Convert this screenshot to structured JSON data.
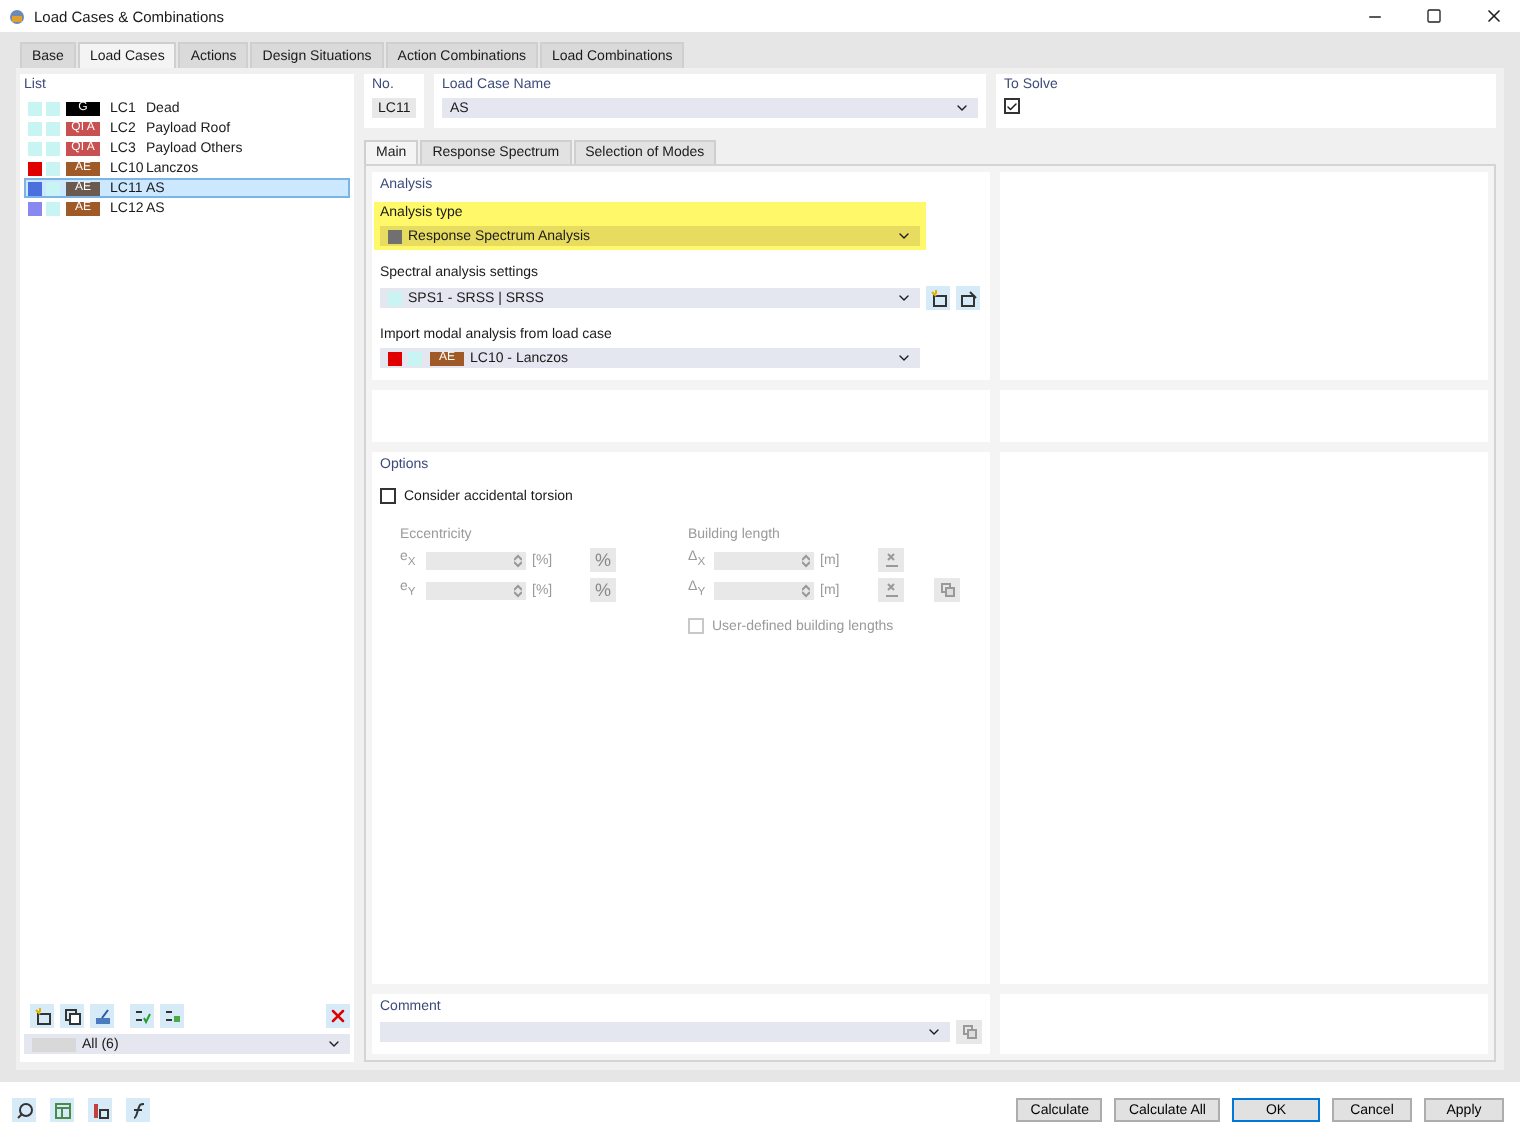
{
  "window": {
    "title": "Load Cases & Combinations"
  },
  "tabs": [
    {
      "label": "Base",
      "selected": false
    },
    {
      "label": "Load Cases",
      "selected": true
    },
    {
      "label": "Actions",
      "selected": false
    },
    {
      "label": "Design Situations",
      "selected": false
    },
    {
      "label": "Action Combinations",
      "selected": false
    },
    {
      "label": "Load Combinations",
      "selected": false
    }
  ],
  "list": {
    "title": "List",
    "items": [
      {
        "color": "#c8f4f4",
        "tag": {
          "text": "G",
          "color": "#000000"
        },
        "number": "LC1",
        "name": "Dead",
        "selected": false
      },
      {
        "color": "#c8f4f4",
        "tag": {
          "text": "QI A",
          "color": "#c85050"
        },
        "number": "LC2",
        "name": "Payload Roof",
        "selected": false
      },
      {
        "color": "#c8f4f4",
        "tag": {
          "text": "QI A",
          "color": "#c85050"
        },
        "number": "LC3",
        "name": "Payload Others",
        "selected": false
      },
      {
        "color": "#e00000",
        "tag": {
          "text": "AE",
          "color": "#a05a28"
        },
        "number": "LC10",
        "name": "Lanczos",
        "selected": false
      },
      {
        "color": "#4a70e0",
        "tag": {
          "text": "AE",
          "color": "#6a5a50"
        },
        "number": "LC11",
        "name": "AS",
        "selected": true
      },
      {
        "color": "#8888f0",
        "tag": {
          "text": "AE",
          "color": "#a05a28"
        },
        "number": "LC12",
        "name": "AS",
        "selected": false
      }
    ],
    "filter": "All (6)"
  },
  "header": {
    "no_label": "No.",
    "no_value": "LC11",
    "name_label": "Load Case Name",
    "name_value": "AS",
    "solve_label": "To Solve",
    "to_solve": true
  },
  "subtabs": [
    {
      "label": "Main",
      "selected": true
    },
    {
      "label": "Response Spectrum",
      "selected": false
    },
    {
      "label": "Selection of Modes",
      "selected": false
    }
  ],
  "analysis": {
    "title": "Analysis",
    "type_label": "Analysis type",
    "type_value": "Response Spectrum Analysis",
    "spectral_label": "Spectral analysis settings",
    "spectral_value": "SPS1 - SRSS | SRSS",
    "import_label": "Import modal analysis from load case",
    "import_swatch": {
      "color": "#e00000"
    },
    "import_tag": {
      "text": "AE",
      "color": "#a05a28"
    },
    "import_value": "LC10 - Lanczos"
  },
  "options": {
    "title": "Options",
    "torsion_label": "Consider accidental torsion",
    "torsion": false,
    "eccentricity_label": "Eccentricity",
    "ecc_rows": [
      {
        "label": "e$_{X}$",
        "unit": "[%]",
        "symbol": "%"
      },
      {
        "label": "e$_{Y}$",
        "unit": "[%]",
        "symbol": "%"
      }
    ],
    "length_label": "Building length",
    "length_rows": [
      {
        "label": "Δ$_{X}$",
        "unit": "[m]"
      },
      {
        "label": "Δ$_{Y}$",
        "unit": "[m]"
      }
    ],
    "user_defined_label": "User-defined building lengths",
    "user_defined": false
  },
  "comment": {
    "label": "Comment"
  },
  "buttons": [
    {
      "label": "Calculate",
      "default": false
    },
    {
      "label": "Calculate All",
      "default": false
    },
    {
      "label": "OK",
      "default": true
    },
    {
      "label": "Cancel",
      "default": false
    },
    {
      "label": "Apply",
      "default": false
    }
  ]
}
